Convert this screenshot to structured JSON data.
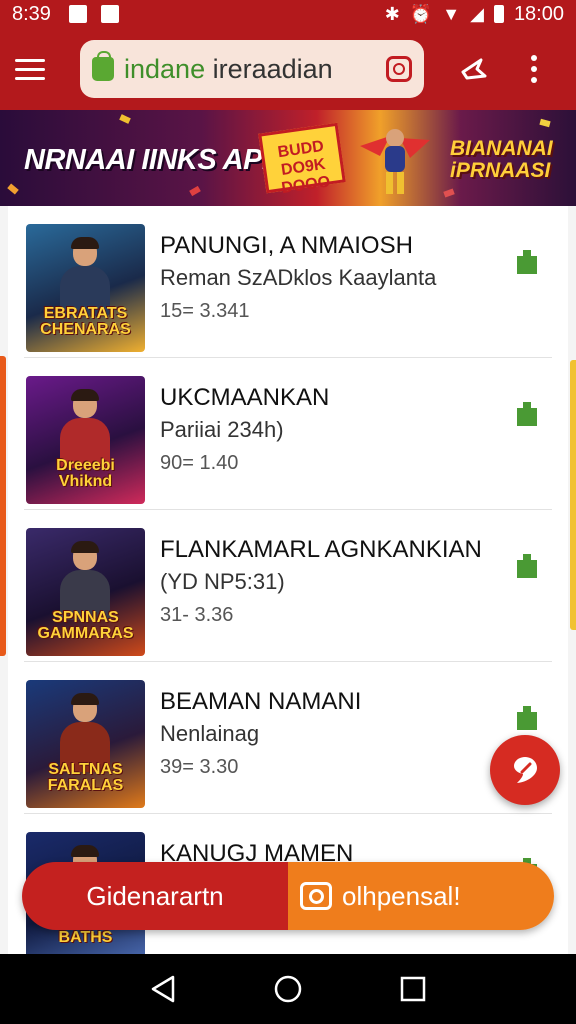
{
  "status_bar": {
    "time": "8:39",
    "clock": "18:00"
  },
  "app_bar": {
    "search_prefix": "indane",
    "search_rest": " ireraadian"
  },
  "banner": {
    "title": "NRNAAI IINKS APR",
    "badge": "BUDD\nDO9K\nDOOO",
    "right_text": "BIANANAI\niPRNAASI"
  },
  "items": [
    {
      "thumb_title": "EBRATATS\nCHENARAS",
      "title": "PANUNGI, A NMAIOSH",
      "subtitle": "Reman SzADklos Kaaylanta",
      "meta": "15= 3.341",
      "thumb_colors": [
        "#2a6a9a",
        "#f0b030"
      ]
    },
    {
      "thumb_title": "Dreeebi Vhiknd",
      "title": "UKCMAANKAN",
      "subtitle": "Pariiai 234h)",
      "meta": "90= 1.40",
      "thumb_colors": [
        "#6a1a8a",
        "#d02a5a"
      ]
    },
    {
      "thumb_title": "SPNNAS\nGAMMARAS",
      "title": "FLANKAMARL AGNKANKIAN",
      "subtitle": "(YD NP5:31)",
      "meta": "31- 3.36",
      "thumb_colors": [
        "#3a2a6a",
        "#d04a1a"
      ]
    },
    {
      "thumb_title": "SALTNAS\nFARALAS",
      "title": "BEAMAN NAMANI",
      "subtitle": "Nenlainag",
      "meta": "39= 3.30",
      "thumb_colors": [
        "#1a3a7a",
        "#e07a1a"
      ]
    },
    {
      "thumb_title": "BATHS",
      "title": "KANUGJ MAMEN",
      "subtitle": "",
      "meta": "",
      "thumb_colors": [
        "#1a2a6a",
        "#4a6ab0"
      ]
    }
  ],
  "action_bar": {
    "left_label": "Gidenarartn",
    "right_label": "olhpensal!"
  },
  "colors": {
    "primary": "#b3191c",
    "accent": "#ef7d1c",
    "download": "#4a9a34"
  },
  "icons": {
    "menu": "menu-icon",
    "search_bag": "shopping-bag-icon",
    "lens": "camera-lens-icon",
    "share": "share-icon",
    "more": "more-vert-icon",
    "download": "download-icon",
    "fab": "navigate-icon"
  }
}
